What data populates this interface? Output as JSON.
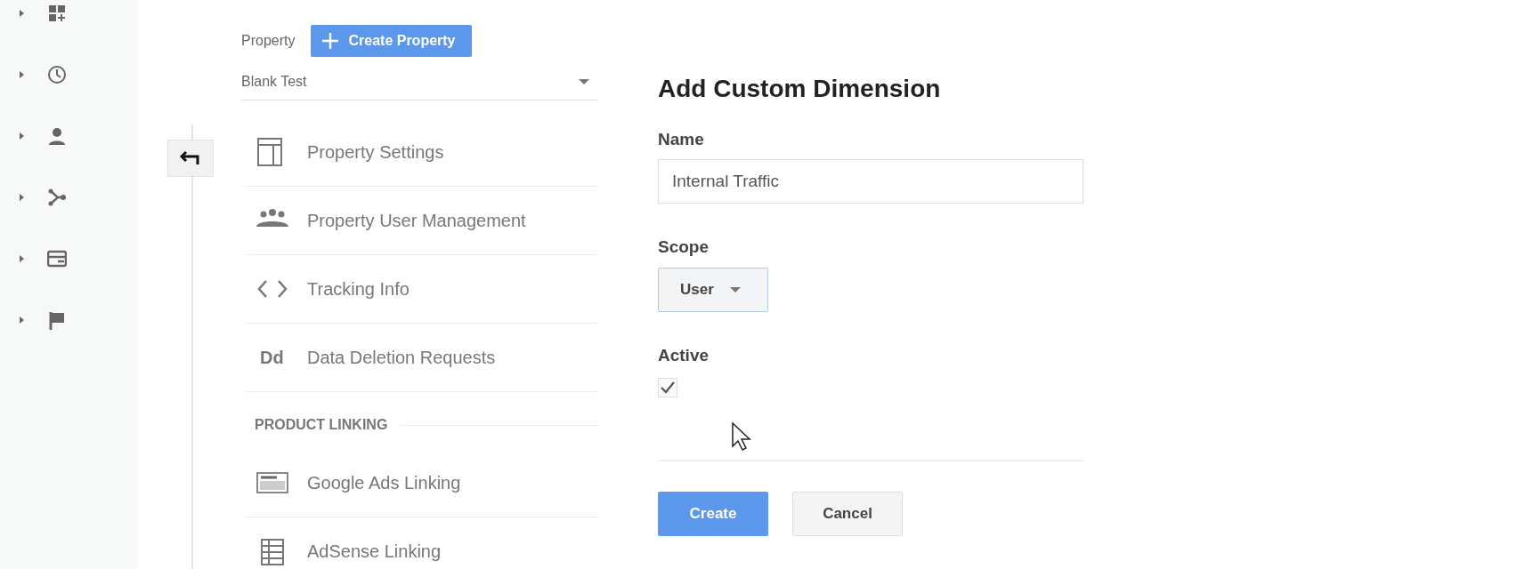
{
  "rail": {
    "items": [
      {
        "expanded": false
      },
      {
        "expanded": false
      },
      {
        "expanded": false
      },
      {
        "expanded": false
      },
      {
        "expanded": false
      },
      {
        "expanded": false
      }
    ]
  },
  "property": {
    "label": "Property",
    "create_button": "Create Property",
    "selector": "Blank Test",
    "items": [
      {
        "kind": "item",
        "label": "Property Settings"
      },
      {
        "kind": "item",
        "label": "Property User Management"
      },
      {
        "kind": "item",
        "label": "Tracking Info"
      },
      {
        "kind": "item",
        "label": "Data Deletion Requests",
        "icon_text": "Dd"
      },
      {
        "kind": "heading",
        "label": "PRODUCT LINKING"
      },
      {
        "kind": "item",
        "label": "Google Ads Linking"
      },
      {
        "kind": "item",
        "label": "AdSense Linking"
      }
    ]
  },
  "form": {
    "title": "Add Custom Dimension",
    "name_label": "Name",
    "name_value": "Internal Traffic",
    "scope_label": "Scope",
    "scope_value": "User",
    "active_label": "Active",
    "active": true,
    "buttons": [
      {
        "kind": "primary",
        "label": "Create"
      },
      {
        "kind": "secondary",
        "label": "Cancel"
      }
    ]
  }
}
